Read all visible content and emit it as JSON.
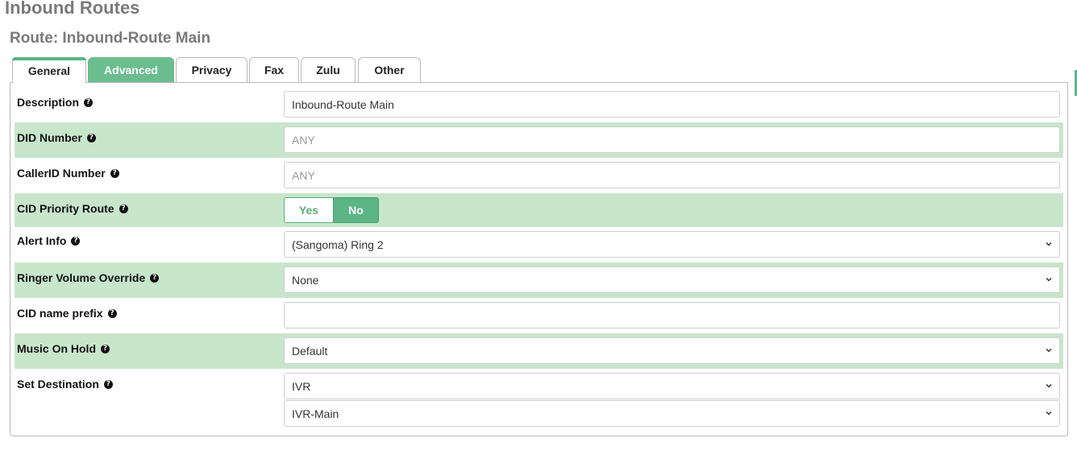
{
  "header": {
    "title": "Inbound Routes",
    "route_title": "Route: Inbound-Route Main"
  },
  "tabs": [
    {
      "label": "General",
      "active": true
    },
    {
      "label": "Advanced",
      "active": false
    },
    {
      "label": "Privacy",
      "active": false
    },
    {
      "label": "Fax",
      "active": false
    },
    {
      "label": "Zulu",
      "active": false
    },
    {
      "label": "Other",
      "active": false
    }
  ],
  "help_glyph": "?",
  "fields": {
    "description": {
      "label": "Description",
      "value": "Inbound-Route Main"
    },
    "did_number": {
      "label": "DID Number",
      "placeholder": "ANY"
    },
    "callerid_number": {
      "label": "CallerID Number",
      "placeholder": "ANY"
    },
    "cid_priority_route": {
      "label": "CID Priority Route",
      "yes_label": "Yes",
      "no_label": "No",
      "selected": "No"
    },
    "alert_info": {
      "label": "Alert Info",
      "value": "(Sangoma) Ring 2"
    },
    "ringer_volume_override": {
      "label": "Ringer Volume Override",
      "value": "None"
    },
    "cid_name_prefix": {
      "label": "CID name prefix",
      "value": ""
    },
    "music_on_hold": {
      "label": "Music On Hold",
      "value": "Default"
    },
    "set_destination": {
      "label": "Set Destination",
      "type_value": "IVR",
      "target_value": "IVR-Main"
    }
  },
  "colors": {
    "accent": "#5bb58a",
    "row_shade": "#c8e6cb",
    "title_gray": "#7a7a7a"
  }
}
